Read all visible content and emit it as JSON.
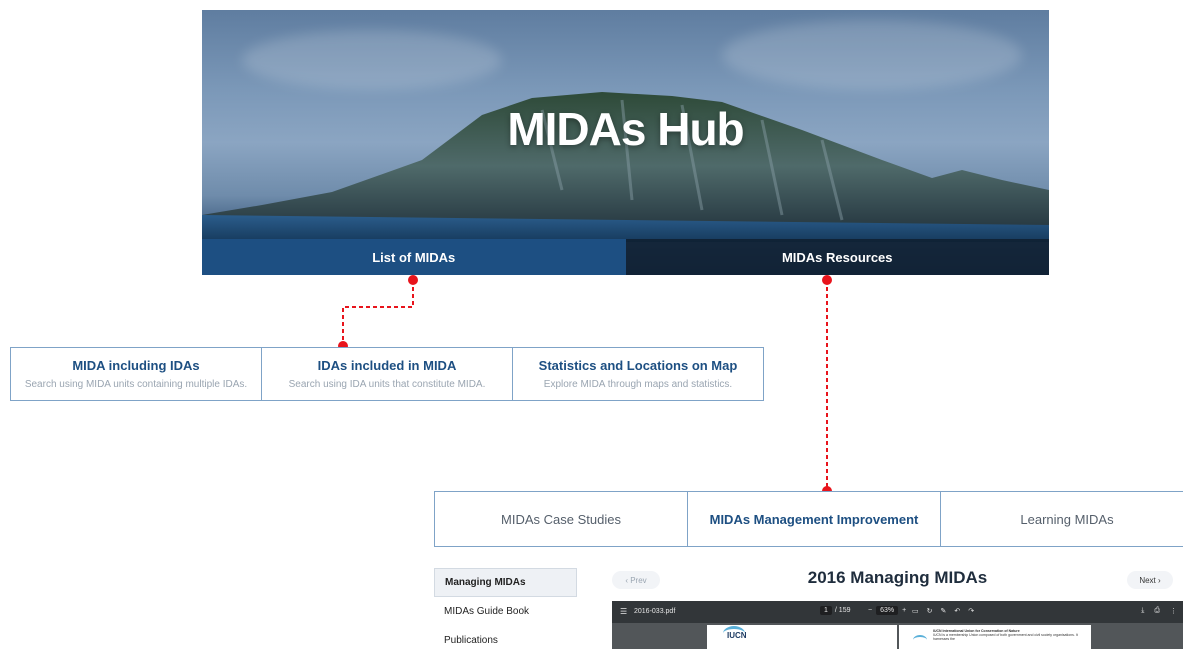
{
  "hero": {
    "title": "MIDAs Hub",
    "tabs": [
      {
        "label": "List of MIDAs"
      },
      {
        "label": "MIDAs Resources"
      }
    ]
  },
  "mida_cards": [
    {
      "title": "MIDA including IDAs",
      "description": "Search using MIDA units containing multiple IDAs."
    },
    {
      "title": "IDAs included in MIDA",
      "description": "Search using IDA units that constitute MIDA."
    },
    {
      "title": "Statistics and Locations on Map",
      "description": "Explore MIDA through maps and statistics."
    }
  ],
  "resource_tabs": [
    {
      "label": "MIDAs Case Studies",
      "active": false
    },
    {
      "label": "MIDAs Management Improvement",
      "active": true
    },
    {
      "label": "Learning MIDAs",
      "active": false
    }
  ],
  "sidebar": {
    "items": [
      {
        "label": "Managing MIDAs",
        "active": true
      },
      {
        "label": "MIDAs Guide Book",
        "active": false
      },
      {
        "label": "Publications",
        "active": false
      }
    ]
  },
  "document": {
    "title": "2016 Managing MIDAs",
    "prev_label": "‹  Prev",
    "next_label": "Next  ›"
  },
  "pdf_viewer": {
    "file_name": "2016-033.pdf",
    "current_page": "1",
    "total_pages": "/ 159",
    "zoom": "63%",
    "page_logo_text": "IUCN",
    "page_right_heading": "IUCN International Union for Conservation of Nature",
    "page_right_text": "IUCN is a membership Union composed of both government and civil society organisations. It harnesses the"
  },
  "colors": {
    "primary": "#1d4f82",
    "border": "#7fa3c7",
    "connector": "#e8141c"
  }
}
